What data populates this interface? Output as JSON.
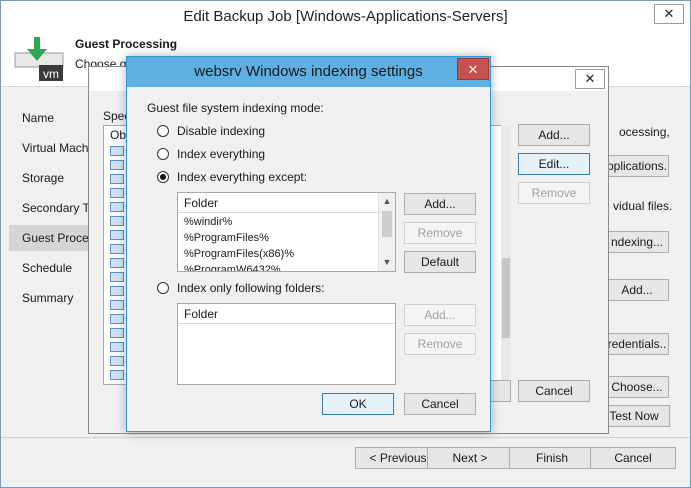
{
  "main": {
    "title": "Edit Backup Job [Windows-Applications-Servers]",
    "close": "✕",
    "header_title": "Guest Processing",
    "header_desc": "Choose gu",
    "logo_text": "vm",
    "nav": [
      "Name",
      "Virtual Mach",
      "Storage",
      "Secondary T",
      "Guest Proce",
      "Schedule",
      "Summary"
    ],
    "right_texts": [
      "ocessing,",
      "vidual files."
    ],
    "right_buttons": [
      "pplications.",
      "ndexing...",
      "Add...",
      "redentials..",
      "Choose...",
      "Test Now"
    ],
    "footer": {
      "previous": "< Previous",
      "next": "Next >",
      "finish": "Finish",
      "cancel": "Cancel"
    }
  },
  "bg_dialog": {
    "close": "✕",
    "label": "Spec",
    "list_header": "Obj",
    "buttons": {
      "add": "Add...",
      "edit": "Edit...",
      "remove": "Remove",
      "cancel": "Cancel"
    }
  },
  "dialog": {
    "title": "websrv Windows indexing settings",
    "close": "✕",
    "mode_label": "Guest file system indexing mode:",
    "options": {
      "disable": "Disable indexing",
      "everything": "Index everything",
      "except": "Index everything except:",
      "only": "Index only following folders:"
    },
    "selected": "except",
    "except_list": {
      "header": "Folder",
      "rows": [
        "%windir%",
        "%ProgramFiles%",
        "%ProgramFiles(x86)%",
        "%ProgramW6432%"
      ]
    },
    "except_buttons": {
      "add": "Add...",
      "remove": "Remove",
      "default": "Default"
    },
    "only_list": {
      "header": "Folder",
      "rows": []
    },
    "only_buttons": {
      "add": "Add...",
      "remove": "Remove"
    },
    "ok": "OK",
    "cancel": "Cancel"
  },
  "colors": {
    "title_accent": "#5fb0e2",
    "close_red": "#c75050",
    "logo_green": "#2fa84f"
  }
}
